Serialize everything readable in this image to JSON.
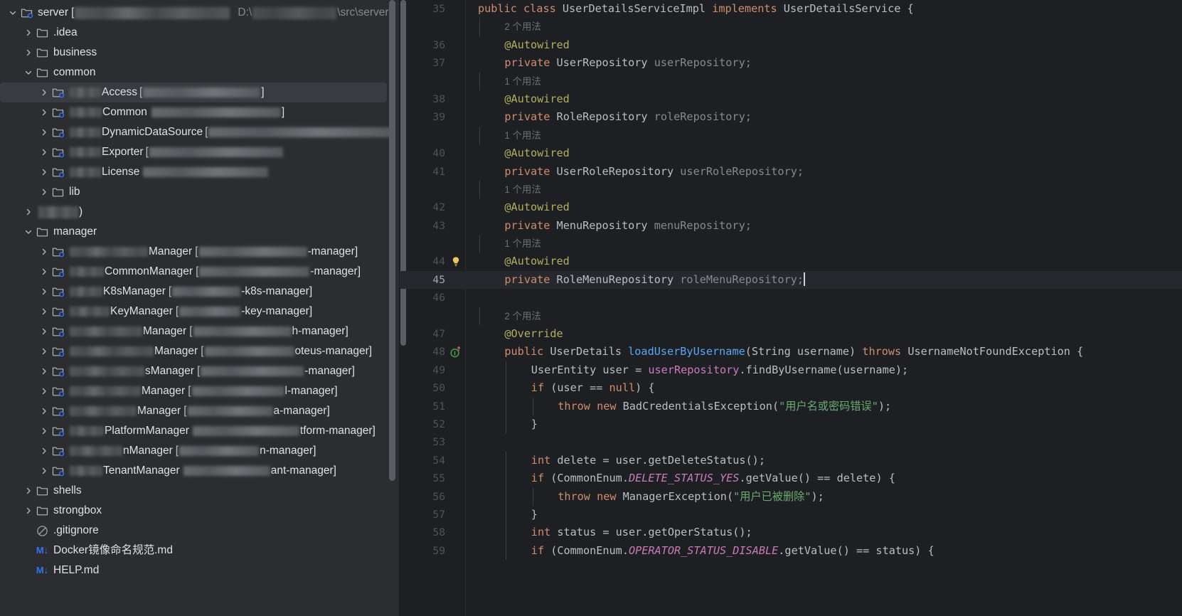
{
  "project_tree": {
    "root": {
      "name": "server",
      "path_suffix": "\\src\\server",
      "path_prefix": "D:\\",
      "bracket_open": "[",
      "bracket_close": "]"
    },
    "items": [
      {
        "depth": 0,
        "label": "server",
        "icon": "module-folder-icon",
        "arrow": "down",
        "redacted_after": "bracket",
        "trailing_path": "D:\\ \\src\\server",
        "selected": false
      },
      {
        "depth": 1,
        "label": ".idea",
        "icon": "folder-icon",
        "arrow": "right",
        "selected": false
      },
      {
        "depth": 1,
        "label": "business",
        "icon": "folder-icon",
        "arrow": "right",
        "selected": false
      },
      {
        "depth": 1,
        "label": "common",
        "icon": "folder-icon",
        "arrow": "down",
        "selected": false
      },
      {
        "depth": 2,
        "label": "Access",
        "icon": "module-folder-icon",
        "arrow": "right",
        "selected": true
      },
      {
        "depth": 2,
        "label": "Common",
        "icon": "module-folder-icon",
        "arrow": "right",
        "selected": false
      },
      {
        "depth": 2,
        "label": "DynamicDataSource",
        "icon": "module-folder-icon",
        "arrow": "right",
        "selected": false
      },
      {
        "depth": 2,
        "label": "Exporter",
        "icon": "module-folder-icon",
        "arrow": "right",
        "selected": false
      },
      {
        "depth": 2,
        "label": "License",
        "icon": "module-folder-icon",
        "arrow": "right",
        "selected": false
      },
      {
        "depth": 2,
        "label": "lib",
        "icon": "folder-icon",
        "arrow": "right",
        "selected": false
      },
      {
        "depth": 1,
        "label": "",
        "icon": "folder-icon",
        "arrow": "right",
        "selected": false
      },
      {
        "depth": 1,
        "label": "manager",
        "icon": "folder-icon",
        "arrow": "down",
        "selected": false
      },
      {
        "depth": 2,
        "label": "Manager",
        "suffix": "-manager]",
        "icon": "module-folder-icon",
        "arrow": "right",
        "selected": false
      },
      {
        "depth": 2,
        "label": "CommonManager",
        "suffix": "-manager]",
        "icon": "module-folder-icon",
        "arrow": "right",
        "selected": false
      },
      {
        "depth": 2,
        "label": "K8sManager",
        "suffix": "-k8s-manager]",
        "icon": "module-folder-icon",
        "arrow": "right",
        "selected": false
      },
      {
        "depth": 2,
        "label": "KeyManager",
        "suffix": "-key-manager]",
        "icon": "module-folder-icon",
        "arrow": "right",
        "selected": false
      },
      {
        "depth": 2,
        "label": "Manager",
        "suffix": "h-manager]",
        "icon": "module-folder-icon",
        "arrow": "right",
        "selected": false
      },
      {
        "depth": 2,
        "label": "Manager",
        "suffix": "oteus-manager]",
        "icon": "module-folder-icon",
        "arrow": "right",
        "selected": false
      },
      {
        "depth": 2,
        "label": "sManager",
        "suffix": "-manager]",
        "icon": "module-folder-icon",
        "arrow": "right",
        "selected": false
      },
      {
        "depth": 2,
        "label": "Manager",
        "suffix": "l-manager]",
        "icon": "module-folder-icon",
        "arrow": "right",
        "selected": false
      },
      {
        "depth": 2,
        "label": "Manager",
        "suffix": "a-manager]",
        "icon": "module-folder-icon",
        "arrow": "right",
        "selected": false
      },
      {
        "depth": 2,
        "label": "PlatformManager",
        "suffix": "tform-manager]",
        "icon": "module-folder-icon",
        "arrow": "right",
        "selected": false
      },
      {
        "depth": 2,
        "label": "nManager",
        "suffix": "n-manager]",
        "icon": "module-folder-icon",
        "arrow": "right",
        "selected": false
      },
      {
        "depth": 2,
        "label": "TenantManager",
        "suffix": "ant-manager]",
        "icon": "module-folder-icon",
        "arrow": "right",
        "selected": false
      },
      {
        "depth": 1,
        "label": "shells",
        "icon": "folder-icon",
        "arrow": "right",
        "selected": false
      },
      {
        "depth": 1,
        "label": "strongbox",
        "icon": "folder-icon",
        "arrow": "right",
        "selected": false
      },
      {
        "depth": 1,
        "label": ".gitignore",
        "icon": "gitignore-icon",
        "arrow": "none",
        "selected": false
      },
      {
        "depth": 1,
        "label": "Docker镜像命名规范.md",
        "icon": "markdown-icon",
        "arrow": "none",
        "selected": false
      },
      {
        "depth": 1,
        "label": "HELP.md",
        "icon": "markdown-icon",
        "arrow": "none",
        "selected": false
      }
    ],
    "labels": {
      "idea": ".idea",
      "business": "business",
      "common": "common",
      "lib": "lib",
      "manager": "manager",
      "shells": "shells",
      "strongbox": "strongbox",
      "gitignore": ".gitignore",
      "docker_md": "Docker镜像命名规范.md",
      "help_md": "HELP.md",
      "server": "server",
      "server_path": "D:\\",
      "server_path_tail": "\\src\\server",
      "access": "Access",
      "common_mod": "Common",
      "dyn": "DynamicDataSource",
      "exporter": "Exporter",
      "license": "License",
      "m_manager": "Manager",
      "m_common_manager": "CommonManager",
      "m_k8s_manager": "K8sManager",
      "m_key_manager": "KeyManager",
      "m_platform_manager": "PlatformManager",
      "m_n_manager": "nManager",
      "m_tenant_manager": "TenantManager",
      "m_s_manager": "sManager",
      "sfx_manager": "-manager]",
      "sfx_k8s": "-k8s-manager]",
      "sfx_key": "-key-manager]",
      "sfx_h": "h-manager]",
      "sfx_oteus": "oteus-manager]",
      "sfx_l": "l-manager]",
      "sfx_a": "a-manager]",
      "sfx_tform": "tform-manager]",
      "sfx_n": "n-manager]",
      "sfx_ant": "ant-manager]",
      "bracket_open": "[",
      "md_badge": "M↓"
    }
  },
  "editor": {
    "current_line": 45,
    "lines": [
      {
        "num": "35",
        "indent": 0,
        "tokens": [
          {
            "t": "public ",
            "c": "kw"
          },
          {
            "t": "class ",
            "c": "kw"
          },
          {
            "t": "UserDetailsServiceImpl ",
            "c": "cls"
          },
          {
            "t": "implements ",
            "c": "kw"
          },
          {
            "t": "UserDetailsService ",
            "c": "cls"
          },
          {
            "t": "{",
            "c": "punc"
          }
        ]
      },
      {
        "num": "",
        "hint": "2 个用法",
        "indent": 1
      },
      {
        "num": "36",
        "indent": 1,
        "tokens": [
          {
            "t": "@Autowired",
            "c": "ann"
          }
        ]
      },
      {
        "num": "37",
        "indent": 1,
        "tokens": [
          {
            "t": "private ",
            "c": "kw"
          },
          {
            "t": "UserRepository ",
            "c": "cls"
          },
          {
            "t": "userRepository;",
            "c": "var"
          }
        ]
      },
      {
        "num": "",
        "hint": "1 个用法",
        "indent": 1
      },
      {
        "num": "38",
        "indent": 1,
        "tokens": [
          {
            "t": "@Autowired",
            "c": "ann"
          }
        ]
      },
      {
        "num": "39",
        "indent": 1,
        "tokens": [
          {
            "t": "private ",
            "c": "kw"
          },
          {
            "t": "RoleRepository ",
            "c": "cls"
          },
          {
            "t": "roleRepository;",
            "c": "var"
          }
        ]
      },
      {
        "num": "",
        "hint": "1 个用法",
        "indent": 1
      },
      {
        "num": "40",
        "indent": 1,
        "tokens": [
          {
            "t": "@Autowired",
            "c": "ann"
          }
        ]
      },
      {
        "num": "41",
        "indent": 1,
        "tokens": [
          {
            "t": "private ",
            "c": "kw"
          },
          {
            "t": "UserRoleRepository ",
            "c": "cls"
          },
          {
            "t": "userRoleRepository;",
            "c": "var"
          }
        ]
      },
      {
        "num": "",
        "hint": "1 个用法",
        "indent": 1
      },
      {
        "num": "42",
        "indent": 1,
        "tokens": [
          {
            "t": "@Autowired",
            "c": "ann"
          }
        ]
      },
      {
        "num": "43",
        "indent": 1,
        "tokens": [
          {
            "t": "private ",
            "c": "kw"
          },
          {
            "t": "MenuRepository ",
            "c": "cls"
          },
          {
            "t": "menuRepository;",
            "c": "var"
          }
        ]
      },
      {
        "num": "",
        "hint": "1 个用法",
        "indent": 1
      },
      {
        "num": "44",
        "indent": 1,
        "gutter_icon": "lightbulb-icon",
        "tokens": [
          {
            "t": "@Autowired",
            "c": "ann"
          }
        ]
      },
      {
        "num": "45",
        "indent": 1,
        "current": true,
        "caret": true,
        "tokens": [
          {
            "t": "private ",
            "c": "kw"
          },
          {
            "t": "RoleMenuRepository ",
            "c": "cls"
          },
          {
            "t": "roleMenuRepository;",
            "c": "var"
          }
        ]
      },
      {
        "num": "46",
        "indent": 0,
        "tokens": []
      },
      {
        "num": "",
        "hint": "2 个用法",
        "indent": 1
      },
      {
        "num": "47",
        "indent": 1,
        "tokens": [
          {
            "t": "@Override",
            "c": "ann"
          }
        ]
      },
      {
        "num": "48",
        "indent": 1,
        "gutter_icon": "implementing-method-icon",
        "tokens": [
          {
            "t": "public ",
            "c": "kw"
          },
          {
            "t": "UserDetails ",
            "c": "cls"
          },
          {
            "t": "loadUserByUsername",
            "c": "mth"
          },
          {
            "t": "(String username) ",
            "c": "plain"
          },
          {
            "t": "throws ",
            "c": "kw"
          },
          {
            "t": "UsernameNotFoundException ",
            "c": "cls"
          },
          {
            "t": "{",
            "c": "punc"
          }
        ]
      },
      {
        "num": "49",
        "indent": 2,
        "tokens": [
          {
            "t": "UserEntity user = ",
            "c": "plain"
          },
          {
            "t": "userRepository",
            "c": "fld"
          },
          {
            "t": ".findByUsername(username);",
            "c": "plain"
          }
        ]
      },
      {
        "num": "50",
        "indent": 2,
        "tokens": [
          {
            "t": "if ",
            "c": "kw"
          },
          {
            "t": "(user == ",
            "c": "plain"
          },
          {
            "t": "null",
            "c": "kw"
          },
          {
            "t": ") {",
            "c": "plain"
          }
        ]
      },
      {
        "num": "51",
        "indent": 3,
        "tokens": [
          {
            "t": "throw ",
            "c": "kw"
          },
          {
            "t": "new ",
            "c": "kw"
          },
          {
            "t": "BadCredentialsException(",
            "c": "plain"
          },
          {
            "t": "\"用户名或密码错误\"",
            "c": "str"
          },
          {
            "t": ");",
            "c": "plain"
          }
        ]
      },
      {
        "num": "52",
        "indent": 2,
        "tokens": [
          {
            "t": "}",
            "c": "plain"
          }
        ]
      },
      {
        "num": "53",
        "indent": 0,
        "tokens": []
      },
      {
        "num": "54",
        "indent": 2,
        "tokens": [
          {
            "t": "int ",
            "c": "kw"
          },
          {
            "t": "delete = user.getDeleteStatus();",
            "c": "plain"
          }
        ]
      },
      {
        "num": "55",
        "indent": 2,
        "tokens": [
          {
            "t": "if ",
            "c": "kw"
          },
          {
            "t": "(CommonEnum.",
            "c": "plain"
          },
          {
            "t": "DELETE_STATUS_YES",
            "c": "stat"
          },
          {
            "t": ".getValue() == delete) {",
            "c": "plain"
          }
        ]
      },
      {
        "num": "56",
        "indent": 3,
        "tokens": [
          {
            "t": "throw ",
            "c": "kw"
          },
          {
            "t": "new ",
            "c": "kw"
          },
          {
            "t": "ManagerException(",
            "c": "plain"
          },
          {
            "t": "\"用户已被删除\"",
            "c": "str"
          },
          {
            "t": ");",
            "c": "plain"
          }
        ]
      },
      {
        "num": "57",
        "indent": 2,
        "tokens": [
          {
            "t": "}",
            "c": "plain"
          }
        ]
      },
      {
        "num": "58",
        "indent": 2,
        "tokens": [
          {
            "t": "int ",
            "c": "kw"
          },
          {
            "t": "status = user.getOperStatus();",
            "c": "plain"
          }
        ]
      },
      {
        "num": "59",
        "indent": 2,
        "tokens": [
          {
            "t": "if ",
            "c": "kw"
          },
          {
            "t": "(CommonEnum.",
            "c": "plain"
          },
          {
            "t": "OPERATOR_STATUS_DISABLE",
            "c": "stat"
          },
          {
            "t": ".getValue() == status) {",
            "c": "plain"
          }
        ]
      }
    ],
    "hint_usages_2": "2 个用法",
    "hint_usages_1": "1 个用法"
  },
  "colors": {
    "editor_bg": "#1e1f22",
    "panel_bg": "#2b2d30",
    "selection_bg": "#393b40",
    "current_line_bg": "#26282e",
    "text": "#dfe1e5",
    "gutter_text": "#4f5256",
    "keyword": "#cf8e6d",
    "annotation": "#b3ae60",
    "string": "#6aab73",
    "method": "#56a8f5",
    "field": "#c77dbb",
    "static_field": "#c77dbb",
    "identifier": "#bcbec4",
    "local_var": "#868a91",
    "scrollbar": "#5a5d63",
    "module_badge": "#3574f0",
    "markdown_badge": "#3574f0"
  }
}
